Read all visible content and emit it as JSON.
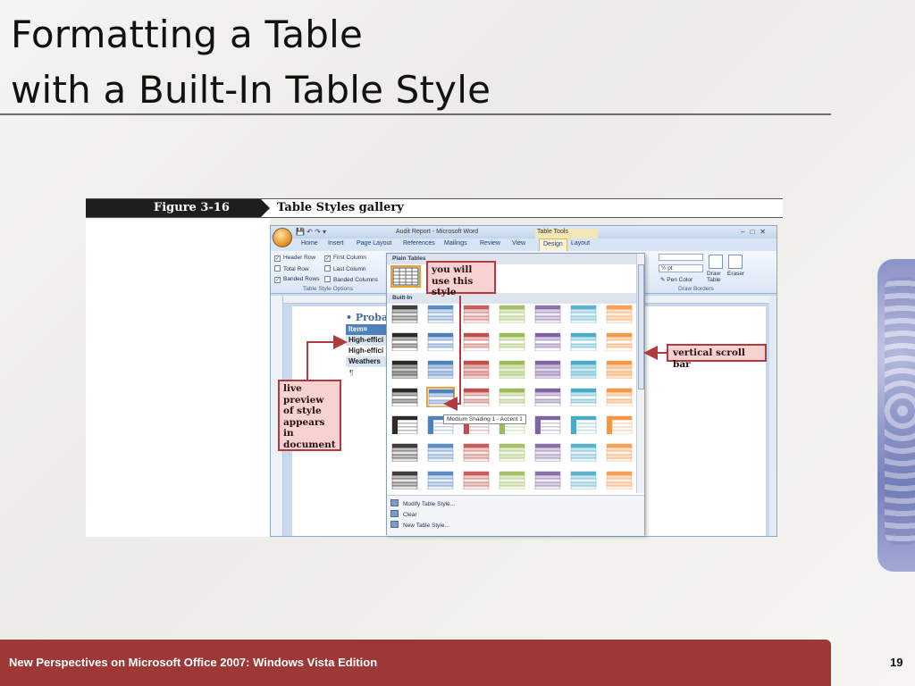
{
  "slide": {
    "title_line1": "Formatting a Table",
    "title_line2": "with a Built-In Table Style",
    "footer": "New Perspectives on Microsoft Office 2007: Windows Vista Edition",
    "page_number": "19"
  },
  "figure": {
    "label": "Figure 3-16",
    "caption": "Table Styles gallery"
  },
  "word": {
    "doc_title": "Audit Report - Microsoft Word",
    "context_tab_title": "Table Tools",
    "tabs": [
      "Home",
      "Insert",
      "Page Layout",
      "References",
      "Mailings",
      "Review",
      "View",
      "Design",
      "Layout"
    ],
    "active_tab": "Design",
    "style_options": [
      {
        "label": "Header Row",
        "checked": true
      },
      {
        "label": "First Column",
        "checked": true
      },
      {
        "label": "Total Row",
        "checked": false
      },
      {
        "label": "Last Column",
        "checked": false
      },
      {
        "label": "Banded Rows",
        "checked": true
      },
      {
        "label": "Banded Columns",
        "checked": false
      }
    ],
    "style_options_group": "Table Style Options",
    "draw_borders": {
      "pen_weight": "½ pt",
      "pen_color": "Pen Color",
      "draw_table": "Draw Table",
      "eraser": "Eraser",
      "group": "Draw Borders"
    },
    "document": {
      "bullet_text": "• Probabl",
      "table_rows": [
        "Item¤",
        "High-effici",
        "High-effici",
        "Weathers"
      ],
      "pilcrow": "¶"
    },
    "gallery": {
      "plain_header": "Plain Tables",
      "builtin_header": "Built-In",
      "tooltip": "Medium Shading 1 - Accent 1",
      "menu": [
        "Modify Table Style...",
        "Clear",
        "New Table Style..."
      ],
      "accent_colors": [
        "#2b2b2b",
        "#4f81bd",
        "#c0504d",
        "#9bbb59",
        "#8064a2",
        "#4bacc6",
        "#f79646"
      ],
      "selected": {
        "row": 3,
        "col": 1
      }
    }
  },
  "callouts": {
    "use_style": "you will use this style",
    "scroll_bar": "vertical scroll bar",
    "live_preview": "live preview of style appears in document"
  }
}
